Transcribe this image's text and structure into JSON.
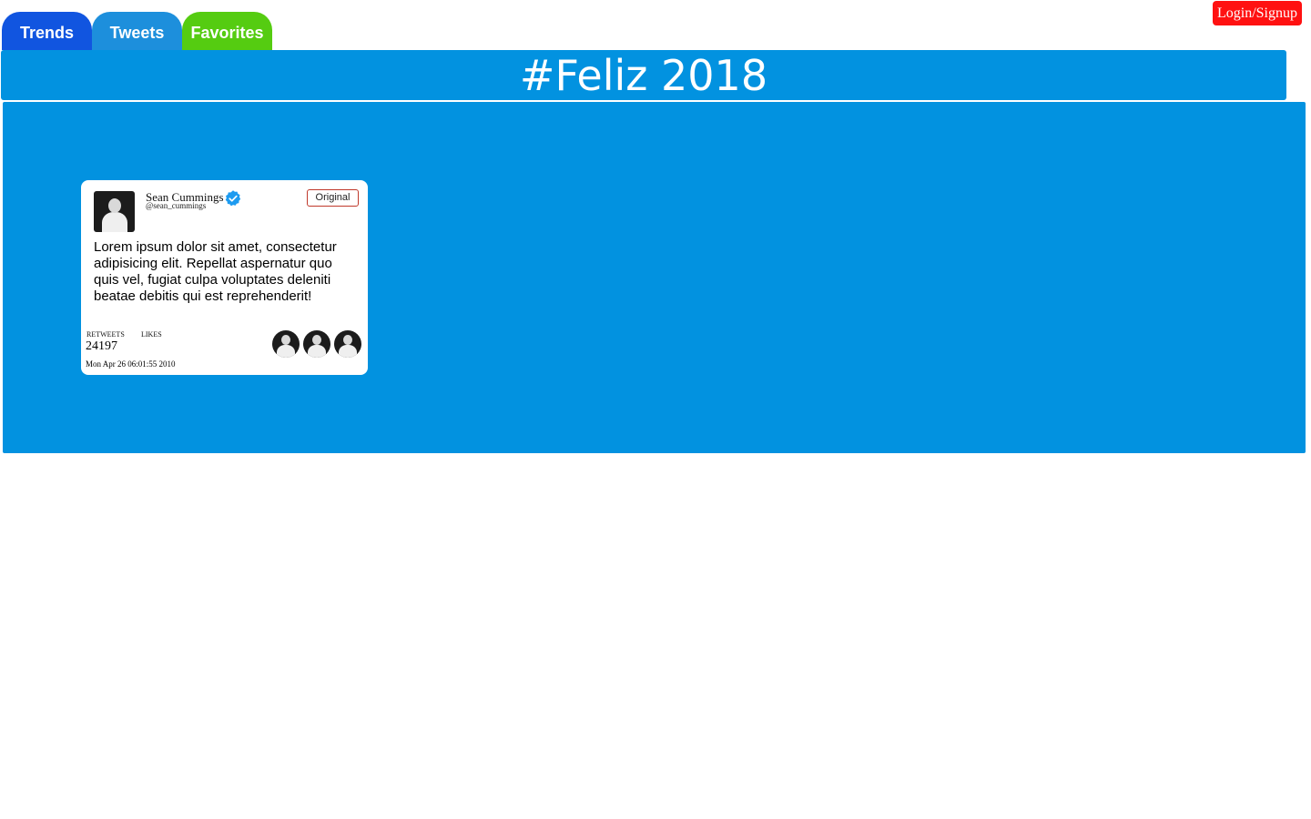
{
  "nav": {
    "tabs": [
      {
        "label": "Trends",
        "color": "#1155e0"
      },
      {
        "label": "Tweets",
        "color": "#1d8fdc"
      },
      {
        "label": "Favorites",
        "color": "#55cc11"
      }
    ]
  },
  "auth": {
    "login_label": "Login/Signup",
    "color": "#ff1111"
  },
  "trend": {
    "title": "#Feliz 2018",
    "color": "#0292e0"
  },
  "content": {
    "background": "#0292e0"
  },
  "tweet": {
    "user_name": "Sean Cummings",
    "handle": "@sean_cummings",
    "verified": true,
    "verified_color": "#1d9bf0",
    "badge_label": "Original",
    "text": "Lorem ipsum dolor sit amet, consectetur adipisicing elit. Repellat aspernatur quo quis vel, fugiat culpa voluptates deleniti beatae debitis qui est reprehenderit!",
    "retweets_label": "RETWEETS",
    "likes_label": "LIKES",
    "retweets_count": "24197",
    "date": "Mon Apr 26 06:01:55 2010",
    "avatar_icon": "person-photo-icon",
    "liker_avatars": [
      "person-photo-icon",
      "person-photo-icon",
      "person-photo-icon"
    ]
  }
}
